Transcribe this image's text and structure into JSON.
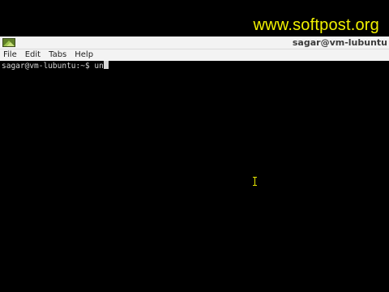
{
  "window": {
    "title": "sagar@vm-lubuntu"
  },
  "menubar": {
    "items": [
      {
        "label": "File"
      },
      {
        "label": "Edit"
      },
      {
        "label": "Tabs"
      },
      {
        "label": "Help"
      }
    ]
  },
  "terminal": {
    "prompt": "sagar@vm-lubuntu:~$ ",
    "input": "un"
  },
  "watermark": {
    "text": "www.softpost.org"
  },
  "colors": {
    "titlebar_bg": "#f3f3f3",
    "terminal_bg": "#000000",
    "terminal_fg": "#d6d6d6",
    "watermark": "#f2f200"
  },
  "icons": {
    "app": "terminal-app-icon",
    "pointer": "i-beam-cursor-icon"
  }
}
